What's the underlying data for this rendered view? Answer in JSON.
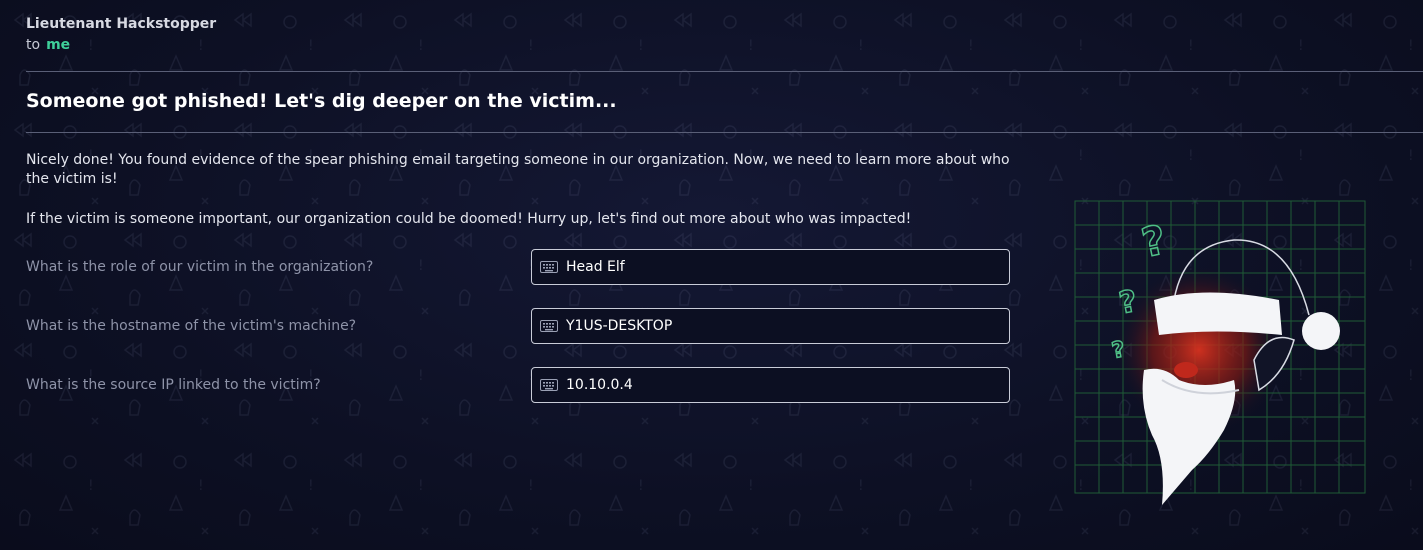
{
  "email": {
    "sender": "Lieutenant Hackstopper",
    "to_label": "to",
    "recipient": "me",
    "subject": "Someone got phished! Let's dig deeper on the victim...",
    "body": [
      "Nicely done! You found evidence of the spear phishing email targeting someone in our organization. Now, we need to learn more about who the victim is!",
      "If the victim is someone important, our organization could be doomed! Hurry up, let's find out more about who was impacted!"
    ]
  },
  "questions": [
    {
      "label": "What is the role of our victim in the organization?",
      "answer": "Head Elf"
    },
    {
      "label": "What is the hostname of the victim's machine?",
      "answer": "Y1US-DESKTOP"
    },
    {
      "label": "What is the source IP linked to the victim?",
      "answer": "10.10.0.4"
    }
  ],
  "icons": {
    "answer_field": "keyboard-icon",
    "illustration": "santa-question-icon"
  },
  "colors": {
    "background": "#0d1024",
    "accent": "#3fcf9a",
    "grid": "#1f5b36",
    "santa_glow": "#c0281c"
  }
}
